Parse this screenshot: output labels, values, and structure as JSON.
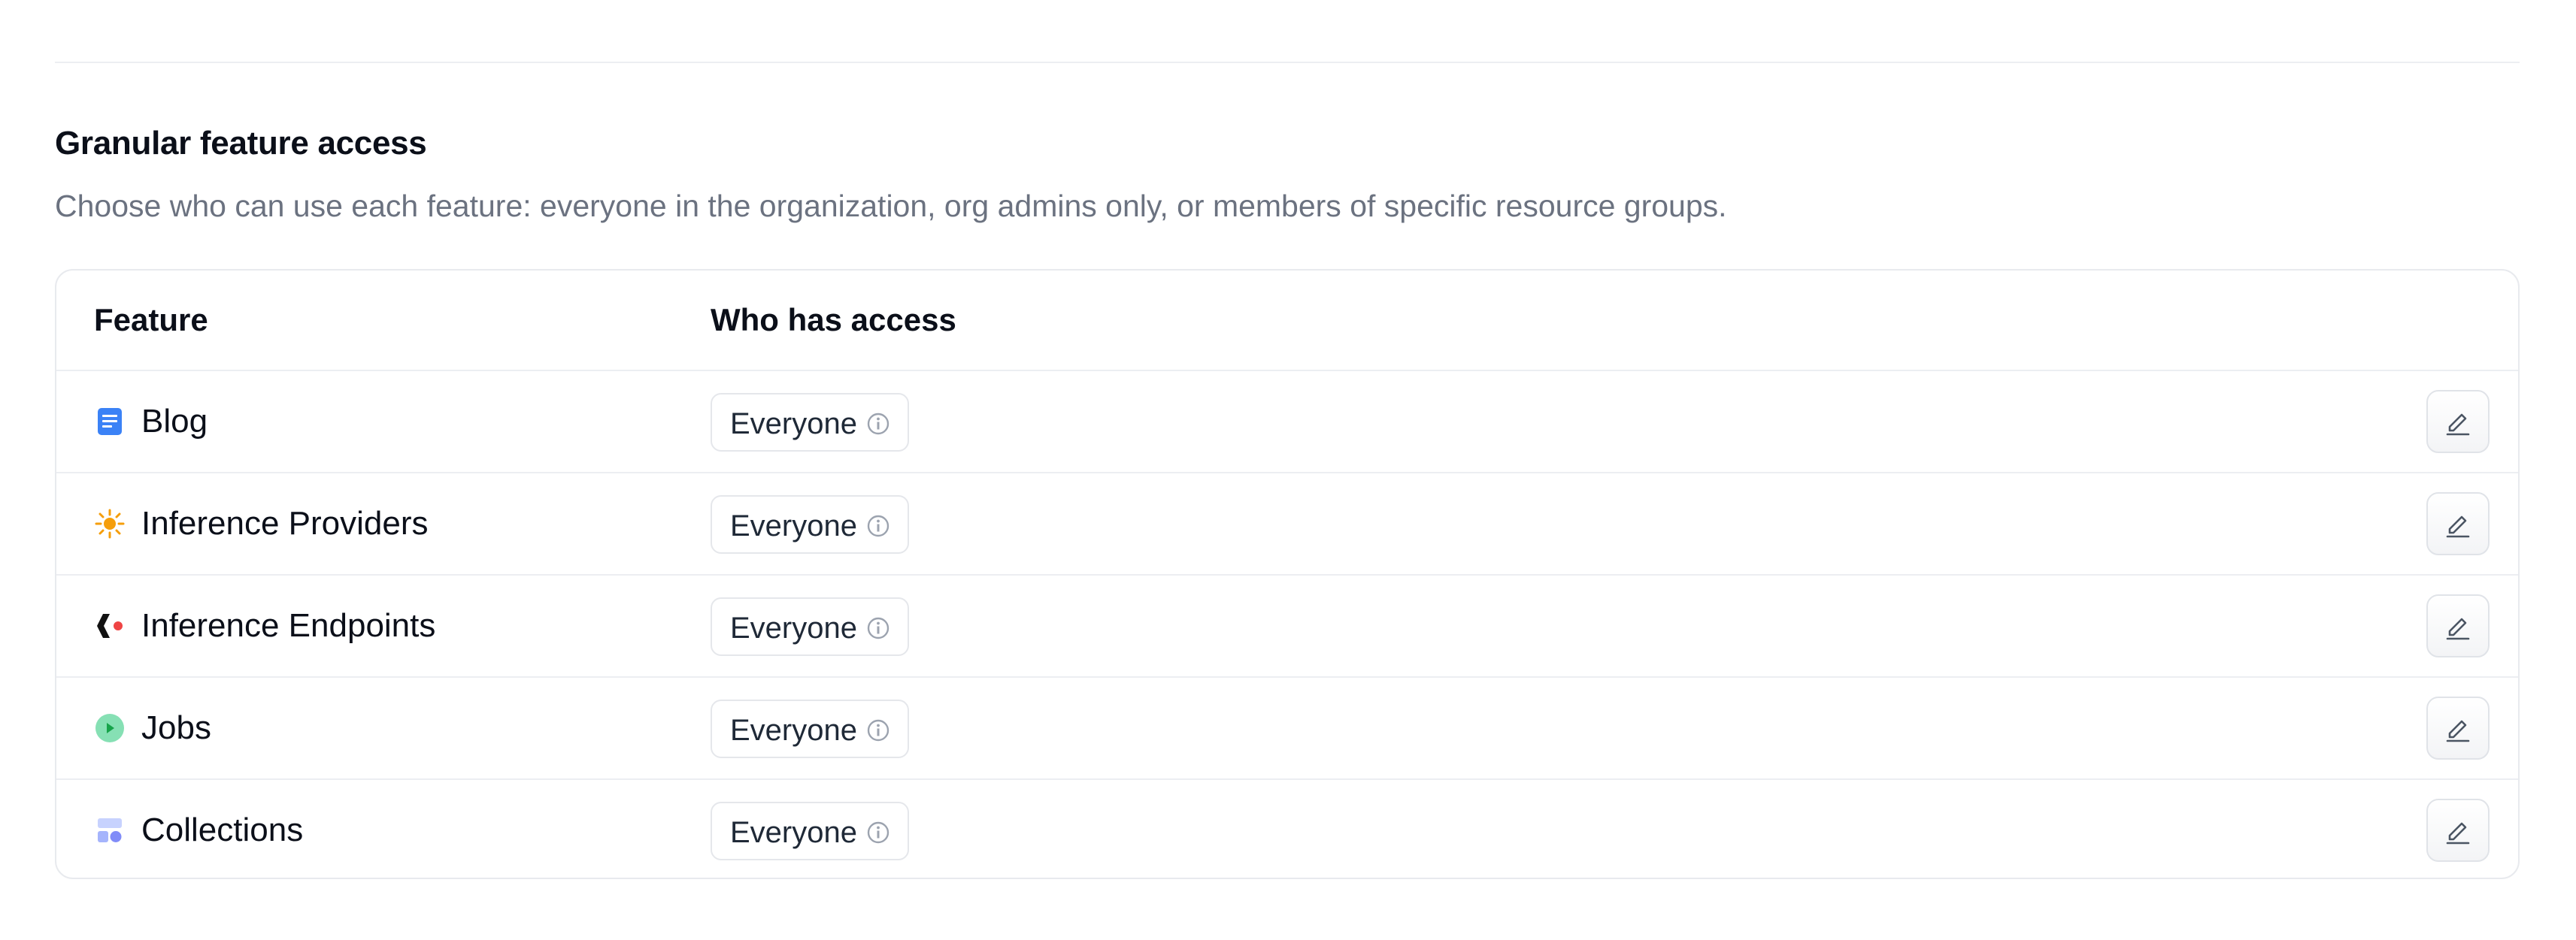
{
  "section": {
    "title": "Granular feature access",
    "description": "Choose who can use each feature: everyone in the organization, org admins only, or members of specific resource groups."
  },
  "table": {
    "headers": {
      "feature": "Feature",
      "access": "Who has access"
    },
    "rows": [
      {
        "feature": "Blog",
        "icon": "blog-icon",
        "icon_color": "#3b82f6",
        "access": "Everyone"
      },
      {
        "feature": "Inference Providers",
        "icon": "sun-icon",
        "icon_color": "#f59e0b",
        "access": "Everyone"
      },
      {
        "feature": "Inference Endpoints",
        "icon": "endpoints-icon",
        "icon_color": "#ef4444",
        "access": "Everyone"
      },
      {
        "feature": "Jobs",
        "icon": "play-circle-icon",
        "icon_color": "#86e0b4",
        "access": "Everyone"
      },
      {
        "feature": "Collections",
        "icon": "collections-icon",
        "icon_color": "#a5b4fc",
        "access": "Everyone"
      }
    ]
  },
  "colors": {
    "border": "#e8eaee",
    "muted_text": "#6b7280"
  }
}
